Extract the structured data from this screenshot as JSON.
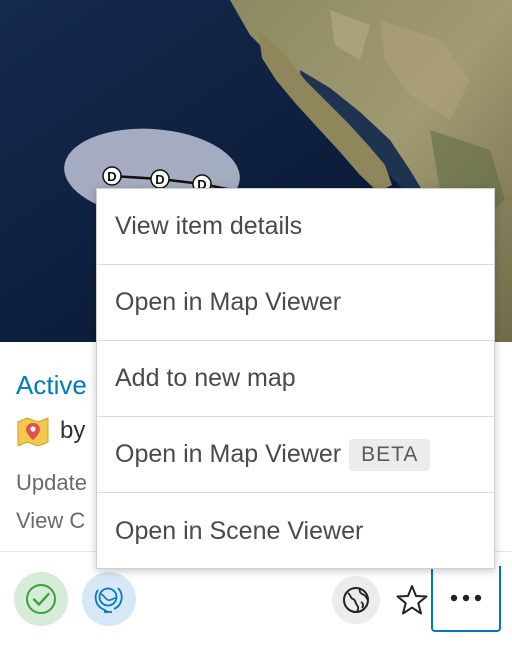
{
  "card": {
    "title": "Active",
    "owner_prefix": "by",
    "updated_text": "Update",
    "views_text": "View C"
  },
  "map": {
    "track_markers": [
      "D",
      "D",
      "D"
    ]
  },
  "menu": {
    "items": [
      {
        "label": "View item details"
      },
      {
        "label": "Open in Map Viewer"
      },
      {
        "label": "Add to new map"
      },
      {
        "label": "Open in Map Viewer",
        "badge": "BETA"
      },
      {
        "label": "Open in Scene Viewer"
      }
    ]
  },
  "footer": {
    "icons": [
      "authoritative-check-icon",
      "sync-globe-icon",
      "globe-icon",
      "star-icon",
      "more-horizontal-icon"
    ],
    "colors": {
      "authoritative_bg": "#d7ecd8",
      "authoritative_fg": "#35a335",
      "sync_bg": "#d6e8f6",
      "sync_fg": "#0079c1",
      "focus_border": "#0079c1"
    }
  },
  "colors": {
    "title": "#0079c1",
    "menu_text": "#4a4a4a",
    "meta_text": "#6a6a6a"
  }
}
